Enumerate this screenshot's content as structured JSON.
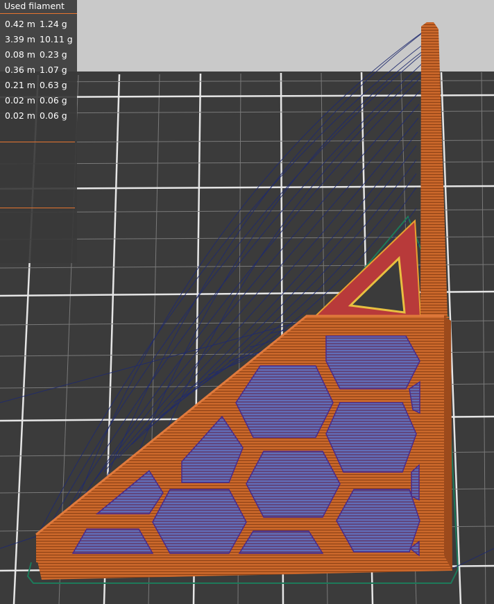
{
  "filament_panel": {
    "title": "Used filament",
    "rows": [
      {
        "length": "0.42 m",
        "weight": "1.24 g"
      },
      {
        "length": "3.39 m",
        "weight": "10.11 g"
      },
      {
        "length": "0.08 m",
        "weight": "0.23 g"
      },
      {
        "length": "0.36 m",
        "weight": "1.07 g"
      },
      {
        "length": "0.21 m",
        "weight": "0.63 g"
      },
      {
        "length": "0.02 m",
        "weight": "0.06 g"
      },
      {
        "length": "0.02 m",
        "weight": "0.06 g"
      }
    ]
  },
  "colors": {
    "bed_background": "#3b3b3b",
    "grid_line": "#ffffff",
    "horizon": "#c9c9c9",
    "filament_orange": "#c8662a",
    "filament_orange_dark": "#8a3f14",
    "travel_blue": "#1f2a6e",
    "infill_red": "#b83a3a",
    "skirt_green": "#1d7a5a",
    "accent": "#e8752f"
  }
}
